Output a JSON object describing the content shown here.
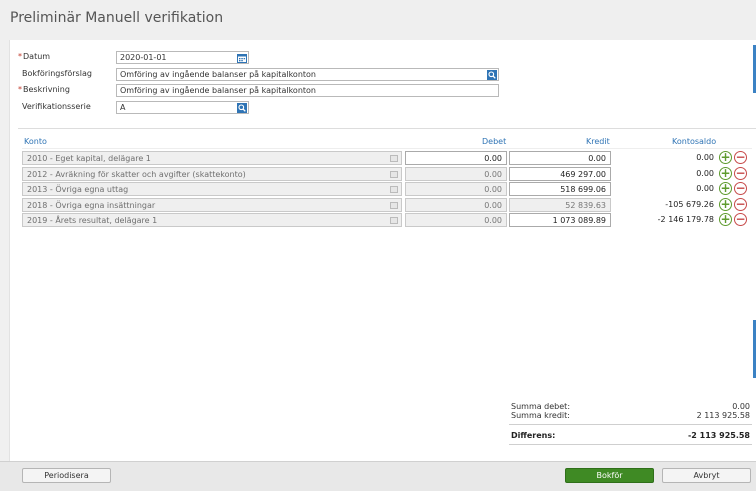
{
  "window": {
    "title": "Preliminär Manuell verifikation"
  },
  "form": {
    "datum": {
      "label": "Datum",
      "value": "2020-01-01",
      "required": true
    },
    "bokforingsforslag": {
      "label": "Bokföringsförslag",
      "value": "Omföring av ingående balanser på kapitalkonton"
    },
    "beskrivning": {
      "label": "Beskrivning",
      "value": "Omföring av ingående balanser på kapitalkonton",
      "required": true
    },
    "verifikationsserie": {
      "label": "Verifikationsserie",
      "value": "A"
    },
    "required_marker": "*"
  },
  "table": {
    "headers": {
      "konto": "Konto",
      "debet": "Debet",
      "kredit": "Kredit",
      "kontosaldo": "Kontosaldo"
    },
    "rows": [
      {
        "account": "2010 - Eget kapital, delägare 1",
        "debet": "0.00",
        "kredit": "0.00",
        "saldo": "0.00"
      },
      {
        "account": "2012 - Avräkning för skatter och avgifter (skattekonto)",
        "debet": "0.00",
        "kredit": "469 297.00",
        "saldo": "0.00"
      },
      {
        "account": "2013 - Övriga egna uttag",
        "debet": "0.00",
        "kredit": "518 699.06",
        "saldo": "0.00"
      },
      {
        "account": "2018 - Övriga egna insättningar",
        "debet": "0.00",
        "kredit": "52 839.63",
        "saldo": "-105 679.26"
      },
      {
        "account": "2019 - Årets resultat, delägare 1",
        "debet": "0.00",
        "kredit": "1 073 089.89",
        "saldo": "-2 146 179.78"
      }
    ],
    "add_symbol": "+",
    "remove_symbol": "−"
  },
  "summary": {
    "summa_debet_label": "Summa debet:",
    "summa_debet": "0.00",
    "summa_kredit_label": "Summa kredit:",
    "summa_kredit": "2 113 925.58",
    "differens_label": "Differens:",
    "differens": "-2 113 925.58"
  },
  "footer": {
    "periodisera": "Periodisera",
    "bokfor": "Bokför",
    "avbryt": "Avbryt"
  },
  "colors": {
    "accent": "#2f74b5",
    "primary_button": "#3f8a24",
    "add": "#5e9b2e",
    "remove": "#c74b4b",
    "required": "#c0392b"
  }
}
